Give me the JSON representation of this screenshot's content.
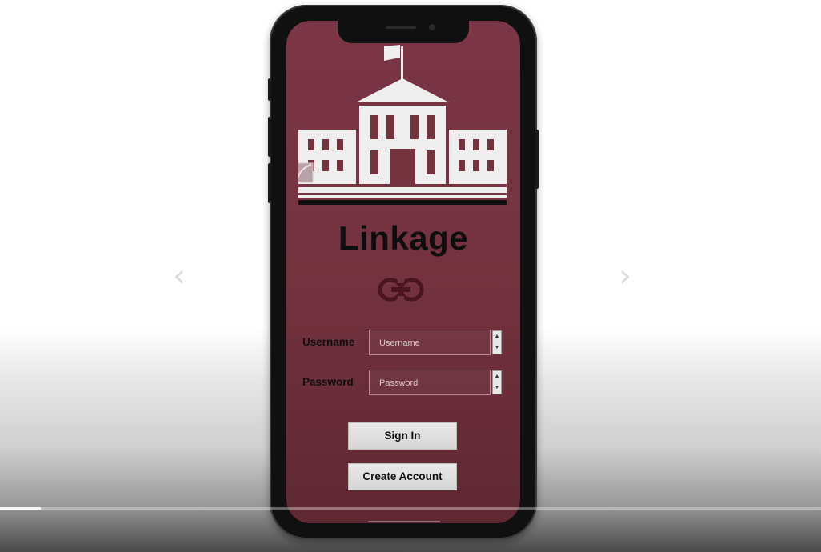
{
  "carousel": {
    "prev_icon": "chevron-left-icon",
    "next_icon": "chevron-right-icon",
    "prev_glyph": "‹",
    "next_glyph": "›"
  },
  "app": {
    "name": "Linkage",
    "logo_icon": "school-building-icon",
    "link_icon": "link-icon",
    "brand_color": "#74323f"
  },
  "form": {
    "username_label": "Username",
    "username_placeholder": "Username",
    "password_label": "Password",
    "password_placeholder": "Password",
    "spinner_up": "▲",
    "spinner_down": "▼"
  },
  "buttons": {
    "sign_in": "Sign In",
    "create_account": "Create Account"
  },
  "video": {
    "progress": 0.05
  }
}
